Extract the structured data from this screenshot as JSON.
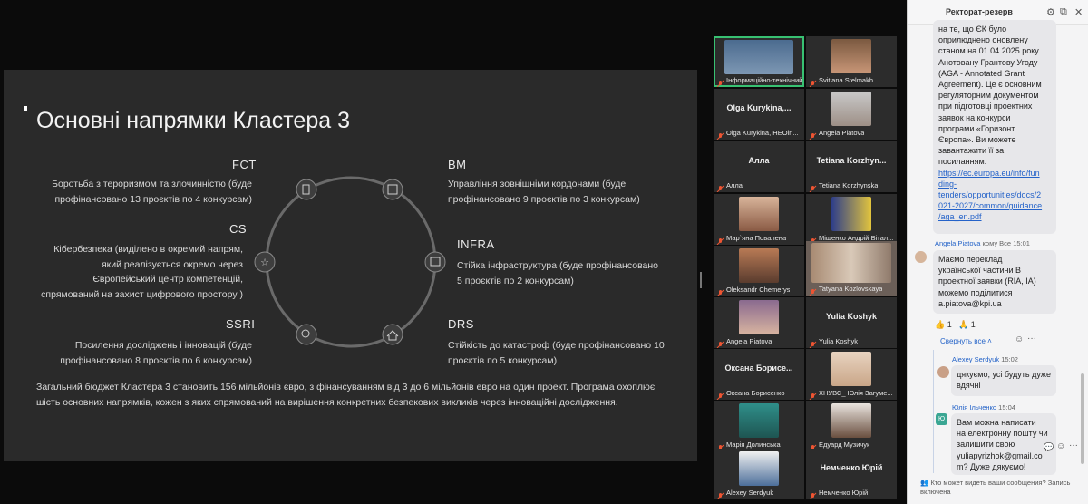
{
  "slide": {
    "title": "Основні напрямки Кластера 3",
    "clusters": {
      "fct": {
        "head": "FCT",
        "text1": "Боротьба з тероризмом та злочинністю (буде",
        "text2": "профінансовано 13 проєктів по 4 конкурсам)"
      },
      "cs": {
        "head": "CS",
        "text1": "Кібербезпека (виділено в окремий напрям,",
        "text2": "який реалізується окремо через",
        "text3": "Європейський центр компетенцій,",
        "text4": "спрямований на захист цифрового простору )"
      },
      "ssri": {
        "head": "SSRI",
        "text1": "Посилення досліджень і інновацій (буде",
        "text2": "профінансовано 8 проєктів по 6 конкурсам)"
      },
      "bm": {
        "head": "BM",
        "text1": "Управління зовнішніми кордонами (буде",
        "text2": "профінансовано 9 проєктів по 3 конкурсам)"
      },
      "infra": {
        "head": "INFRA",
        "text1": "Стійка інфраструктура (буде профінансовано",
        "text2": "5 проєктів по 2 конкурсам)"
      },
      "drs": {
        "head": "DRS",
        "text1": "Стійкість до катастроф (буде профінансовано 10",
        "text2": "проєктів по 5 конкурсам)"
      }
    },
    "summary1": "Загальний бюджет Кластера 3 становить 156 мільйонів євро, з фінансуванням від 3 до 6 мільйонів евро на один проект. Програма охоплює",
    "summary2": "шість основних напрямків, кожен з яких спрямований на вирішення конкретних безпекових викликів через інноваційні дослідження."
  },
  "participants": [
    {
      "name": "Інформаційно-технічний ...",
      "big": ""
    },
    {
      "name": "Svitlana Stelmakh",
      "big": ""
    },
    {
      "name": "Olga Kurykina, HEOin...",
      "big": "Olga  Kurykina,..."
    },
    {
      "name": "Angela Piatova",
      "big": ""
    },
    {
      "name": "Алла",
      "big": "Алла"
    },
    {
      "name": "Tetiana Korzhynska",
      "big": "Tetiana  Korzhyn..."
    },
    {
      "name": "Мар`яна Повалена",
      "big": ""
    },
    {
      "name": "Міщенко Андрій Вітал...",
      "big": ""
    },
    {
      "name": "Oleksandr Chemerys",
      "big": ""
    },
    {
      "name": "Tatyana Kozlovskaya",
      "big": ""
    },
    {
      "name": "Angela Piatova",
      "big": ""
    },
    {
      "name": "Yulia Koshyk",
      "big": "Yulia Koshyk"
    },
    {
      "name": "Оксана Борисенко",
      "big": "Оксана  Борисе..."
    },
    {
      "name": "ХНУВС_ Юлія Загуме...",
      "big": ""
    },
    {
      "name": "Марія Долинська",
      "big": ""
    },
    {
      "name": "Едуард Музичук",
      "big": ""
    },
    {
      "name": "Alexey Serdyuk",
      "big": ""
    },
    {
      "name": "Немченко Юрій",
      "big": "Немченко Юрій"
    }
  ],
  "chat": {
    "title": "Ректорат-резерв",
    "msg1": {
      "lines": [
        "на те, що ЄК було",
        "оприлюднено оновлену",
        "станом на 01.04.2025 року",
        "Анотовану Грантову Угоду",
        "(AGA - Annotated Grant",
        "Agreement). Це є основним",
        "регуляторним документом",
        "при підготовці проектних",
        "заявок на конкурси",
        "програми «Горизонт",
        "Європа». Ви можете",
        "завантажити її за",
        "посиланням:"
      ],
      "link_lines": [
        "https://ec.europa.eu/info/fun",
        "ding-",
        "tenders/opportunities/docs/2",
        "021-2027/common/guidance",
        "/aga_en.pdf"
      ]
    },
    "msg2": {
      "sender": "Angela Piatova",
      "to": "кому Все",
      "time": "15:01",
      "lines": [
        "Маємо переклад",
        "української частини В",
        "проектної заявки (RIA, IA)",
        "можемо поділитися",
        "a.piatova@kpi.ua"
      ],
      "reactions": [
        "👍 1",
        "🙏 1"
      ]
    },
    "collapse": "Свернуть все",
    "reply1": {
      "sender": "Alexey Serdyuk",
      "time": "15:02",
      "lines": [
        "дякуємо, усі будуть дуже",
        "вдячні"
      ]
    },
    "reply2": {
      "sender": "Юлія Ільченко",
      "time": "15:04",
      "avatar_text": "Ю",
      "lines": [
        "Вам можна написати",
        "на електронну пошту чи",
        "залишити свою",
        "yuliapyrizhok@gmail.co",
        "m? Дуже дякуємо!"
      ]
    },
    "footer": "Кто может видеть ваши сообщения? Запись включена"
  }
}
